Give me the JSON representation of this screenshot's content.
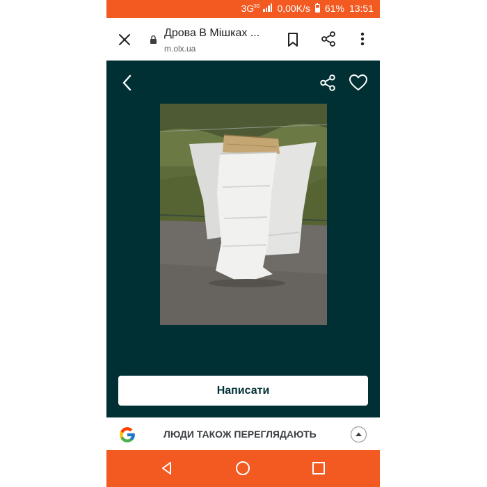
{
  "status_bar": {
    "network": "3G",
    "network_sup": "3G",
    "speed": "0,00K/s",
    "battery": "61%",
    "time": "13:51",
    "color": "#f35a22"
  },
  "browser": {
    "title": "Дрова В Мішках ...",
    "url": "m.olx.ua",
    "icons": [
      "close-icon",
      "lock-icon",
      "bookmark-icon",
      "share-icon",
      "more-vert-icon"
    ]
  },
  "gallery": {
    "background": "#002f34",
    "icons": [
      "chevron-left-icon",
      "share-icon",
      "heart-icon"
    ],
    "write_button_label": "Написати"
  },
  "people_also_viewed": {
    "label": "ЛЮДИ ТАКОЖ ПЕРЕГЛЯДАЮТЬ",
    "icons": [
      "google-icon",
      "chevron-up-icon"
    ]
  },
  "nav_bar": {
    "icons": [
      "nav-back-icon",
      "nav-home-icon",
      "nav-recent-icon"
    ]
  }
}
